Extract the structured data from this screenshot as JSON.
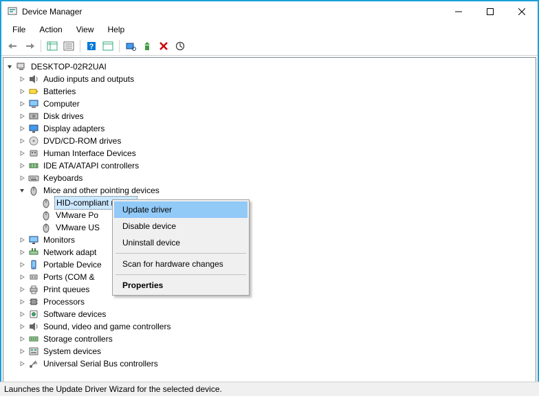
{
  "window": {
    "title": "Device Manager"
  },
  "menus": [
    "File",
    "Action",
    "View",
    "Help"
  ],
  "root": {
    "label": "DESKTOP-02R2UAI"
  },
  "categories": [
    {
      "label": "Audio inputs and outputs",
      "icon": "audio"
    },
    {
      "label": "Batteries",
      "icon": "battery"
    },
    {
      "label": "Computer",
      "icon": "computer"
    },
    {
      "label": "Disk drives",
      "icon": "disk"
    },
    {
      "label": "Display adapters",
      "icon": "display"
    },
    {
      "label": "DVD/CD-ROM drives",
      "icon": "dvd"
    },
    {
      "label": "Human Interface Devices",
      "icon": "hid"
    },
    {
      "label": "IDE ATA/ATAPI controllers",
      "icon": "ide"
    },
    {
      "label": "Keyboards",
      "icon": "keyboard"
    },
    {
      "label": "Mice and other pointing devices",
      "icon": "mouse",
      "expanded": true,
      "children": [
        {
          "label": "HID-compliant mouse",
          "selected": true
        },
        {
          "label": "VMware Po"
        },
        {
          "label": "VMware US"
        }
      ]
    },
    {
      "label": "Monitors",
      "icon": "monitor"
    },
    {
      "label": "Network adapt",
      "icon": "network"
    },
    {
      "label": "Portable Device",
      "icon": "portable"
    },
    {
      "label": "Ports (COM &",
      "icon": "port"
    },
    {
      "label": "Print queues",
      "icon": "printer"
    },
    {
      "label": "Processors",
      "icon": "cpu"
    },
    {
      "label": "Software devices",
      "icon": "software"
    },
    {
      "label": "Sound, video and game controllers",
      "icon": "sound"
    },
    {
      "label": "Storage controllers",
      "icon": "storage"
    },
    {
      "label": "System devices",
      "icon": "system"
    },
    {
      "label": "Universal Serial Bus controllers",
      "icon": "usb"
    }
  ],
  "contextMenu": {
    "items": [
      {
        "label": "Update driver",
        "hover": true
      },
      {
        "label": "Disable device"
      },
      {
        "label": "Uninstall device"
      },
      {
        "sep": true
      },
      {
        "label": "Scan for hardware changes"
      },
      {
        "sep": true
      },
      {
        "label": "Properties",
        "bold": true
      }
    ]
  },
  "status": "Launches the Update Driver Wizard for the selected device."
}
